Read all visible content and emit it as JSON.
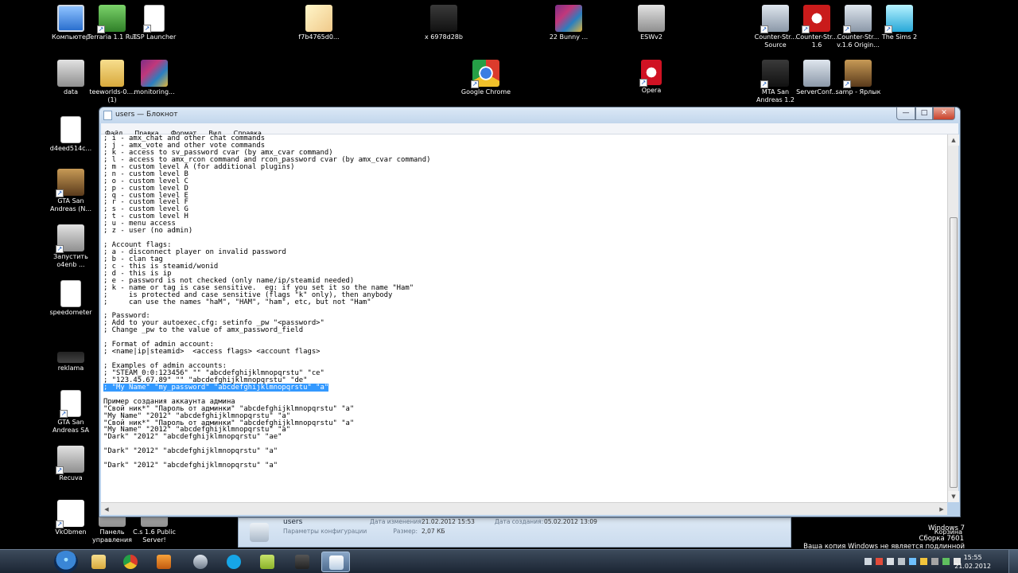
{
  "desktop": {
    "icons": [
      {
        "label": "Компьютер"
      },
      {
        "label": "Terraria 1.1 Rus"
      },
      {
        "label": "TSP Launcher"
      },
      {
        "label": "f7b4765d0..."
      },
      {
        "label": "x 6978d28b"
      },
      {
        "label": "22 Bunny ..."
      },
      {
        "label": "ESWv2"
      },
      {
        "label": "Counter-Str... Source"
      },
      {
        "label": "Counter-Str... 1.6"
      },
      {
        "label": "Counter-Str... v.1.6 Origin..."
      },
      {
        "label": "The Sims 2"
      },
      {
        "label": "data"
      },
      {
        "label": "teeworlds-0.... (1)"
      },
      {
        "label": "monitoring..."
      },
      {
        "label": "Google Chrome"
      },
      {
        "label": "Opera"
      },
      {
        "label": "MTA San Andreas 1.2"
      },
      {
        "label": "ServerConf..."
      },
      {
        "label": "samp - Ярлык"
      },
      {
        "label": "d4eed514c..."
      },
      {
        "label": "GTA San Andreas (N..."
      },
      {
        "label": "Запустить o4enb ..."
      },
      {
        "label": "speedometer"
      },
      {
        "label": "reklama"
      },
      {
        "label": "GTA San Andreas SA"
      },
      {
        "label": "Recuva"
      },
      {
        "label": "VkObmen"
      },
      {
        "label": "Панель управления"
      },
      {
        "label": "C.s 1.6 Public Server!"
      }
    ]
  },
  "notepad": {
    "title": "users — Блокнот",
    "menu": [
      "Файл",
      "Правка",
      "Формат",
      "Вид",
      "Справка"
    ],
    "buttons": {
      "minimize": "—",
      "maximize": "□",
      "close": "✕"
    },
    "lines": [
      "; i - amx_chat and other chat commands",
      "; j - amx_vote and other vote commands",
      "; k - access to sv_password cvar (by amx_cvar command)",
      "; l - access to amx_rcon command and rcon_password cvar (by amx_cvar command)",
      "; m - custom level A (for additional plugins)",
      "; n - custom level B",
      "; o - custom level C",
      "; p - custom level D",
      "; q - custom level E",
      "; r - custom level F",
      "; s - custom level G",
      "; t - custom level H",
      "; u - menu access",
      "; z - user (no admin)",
      "",
      "; Account flags:",
      "; a - disconnect player on invalid password",
      "; b - clan tag",
      "; c - this is steamid/wonid",
      "; d - this is ip",
      "; e - password is not checked (only name/ip/steamid needed)",
      "; k - name or tag is case sensitive.  eg: if you set it so the name \"Ham\"",
      ";     is protected and case sensitive (flags \"k\" only), then anybody",
      ";     can use the names \"haM\", \"HAM\", \"ham\", etc, but not \"Ham\"",
      "",
      "; Password:",
      "; Add to your autoexec.cfg: setinfo _pw \"<password>\"",
      "; Change _pw to the value of amx_password_field",
      "",
      "; Format of admin account:",
      "; <name|ip|steamid>  <access flags> <account flags>",
      "",
      "; Examples of admin accounts:",
      "; \"STEAM_0:0:123456\" \"\" \"abcdefghijklmnopqrstu\" \"ce\"",
      "; \"123.45.67.89\" \"\" \"abcdefghijklmnopqrstu\" \"de\"",
      "; \"My Name\" \"my_password\" \"abcdefghijklmnopqrstu\" \"a\"",
      "",
      "Пример создания аккаунта админа",
      "\"Свой ник*\" \"Пароль от админки\" \"abcdefghijklmnopqrstu\" \"a\"",
      "\"My Name\" \"2012\" \"abcdefghijklmnopqrstu\" \"a\"",
      "\"Свой ник*\" \"Пароль от админки\" \"abcdefghijklmnopqrstu\" \"a\"",
      "\"My Name\" \"2012\" \"abcdefghijklmnopqrstu\" \"a\"",
      "\"Dark\" \"2012\" \"abcdefghijklmnopqrstu\" \"ae\"",
      "",
      "\"Dark\" \"2012\" \"abcdefghijklmnopqrstu\" \"a\"",
      "",
      "\"Dark\" \"2012\" \"abcdefghijklmnopqrstu\" \"a\""
    ],
    "selected_line": 35
  },
  "details_pane": {
    "name": "users",
    "type": "Параметры конфигурации",
    "modified_label": "Дата изменения:",
    "modified_value": "21.02.2012 15:53",
    "created_label": "Дата создания:",
    "created_value": "05.02.2012 13:09",
    "size_label": "Размер:",
    "size_value": "2,07 КБ"
  },
  "watermark": {
    "line1": "Windows 7",
    "line2": "Сборка 7601",
    "line3": "Ваша копия Windows не является подлинной",
    "recycle": "Корзина"
  },
  "taskbar": {
    "time": "15:55",
    "date": "21.02.2012"
  },
  "colors": {
    "selection": "#3399ff",
    "window_frame": "#b9d1ea",
    "taskbar": "#1b2533"
  }
}
